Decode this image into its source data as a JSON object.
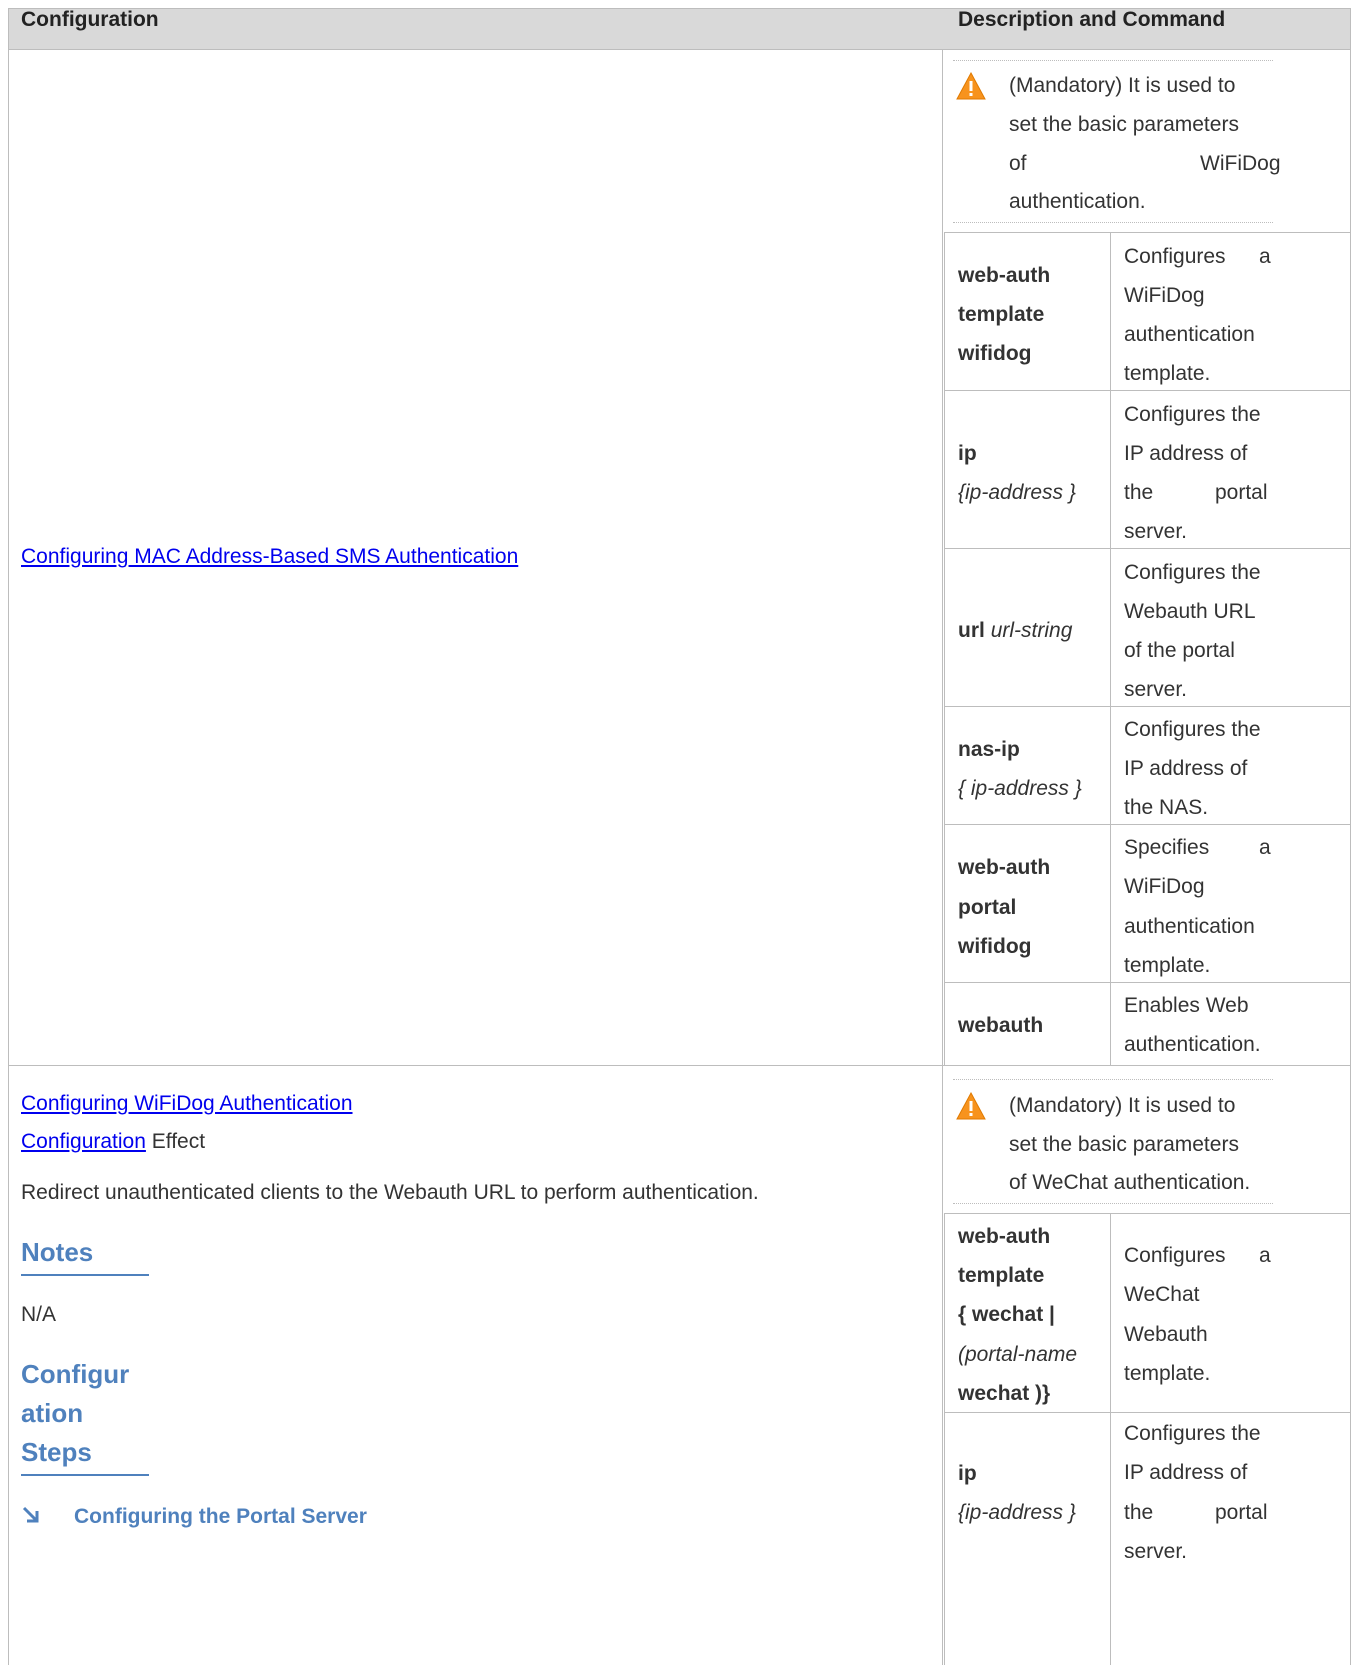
{
  "header": {
    "col1": "Configuration",
    "col2": "Description and Command"
  },
  "row1": {
    "link": "Configuring MAC Address-Based SMS Authentication",
    "note": [
      "(Mandatory) It is used to",
      "set the basic parameters",
      "of",
      "WiFiDog",
      "authentication."
    ],
    "commands": [
      {
        "cmd": [
          "web-auth",
          "template",
          "wifidog"
        ],
        "desc": [
          "Configures",
          "a",
          "WiFiDog",
          "authentication",
          "template."
        ]
      },
      {
        "cmd_bold": "ip",
        "cmd_rest": "{ip-address }",
        "desc": [
          "Configures the",
          "IP address of",
          "the",
          "portal",
          "server."
        ]
      },
      {
        "cmd_bold": "url",
        "cmd_italic": "url-string",
        "desc": [
          "Configures the",
          "Webauth URL",
          "of the portal",
          "server."
        ]
      },
      {
        "cmd_bold": "nas-ip",
        "cmd_rest": "{ ip-address }",
        "desc": [
          "Configures the",
          "IP address of",
          "the NAS."
        ]
      },
      {
        "cmd": [
          "web-auth",
          "portal",
          "wifidog"
        ],
        "desc": [
          "Specifies",
          "a",
          "WiFiDog",
          "authentication",
          "template."
        ]
      },
      {
        "cmd_bold": "webauth",
        "desc": [
          "Enables Web",
          "authentication."
        ]
      }
    ]
  },
  "row2": {
    "link1": "Configuring WiFiDog Authentication",
    "link2": "Configuration",
    "effect": "Effect",
    "body": "Redirect unauthenticated clients to the Webauth URL to perform authentication.",
    "notes_title": "Notes",
    "notes_text": "N/A",
    "steps_title": [
      "Configur",
      "ation",
      "Steps"
    ],
    "portal_heading": "Configuring the Portal Server",
    "note": [
      "(Mandatory) It is used to",
      "set the basic parameters",
      "of WeChat authentication."
    ],
    "commands": [
      {
        "cmd": [
          "web-auth",
          "template",
          "{ wechat |",
          "(portal-name",
          "wechat )}"
        ],
        "desc": [
          "Configures",
          "a",
          "WeChat",
          "Webauth",
          "template."
        ]
      },
      {
        "cmd_bold": "ip",
        "cmd_rest": "{ip-address }",
        "desc": [
          "Configures the",
          "IP address of",
          "the",
          "portal",
          "server."
        ]
      }
    ]
  },
  "colors": {
    "header_bg": "#d9d9d9",
    "link": "#0000ee",
    "heading": "#4f81bd",
    "warning": "#f7931e"
  },
  "icons": {
    "warning": "warning-triangle-icon",
    "arrow": "arrow-down-right-icon"
  }
}
